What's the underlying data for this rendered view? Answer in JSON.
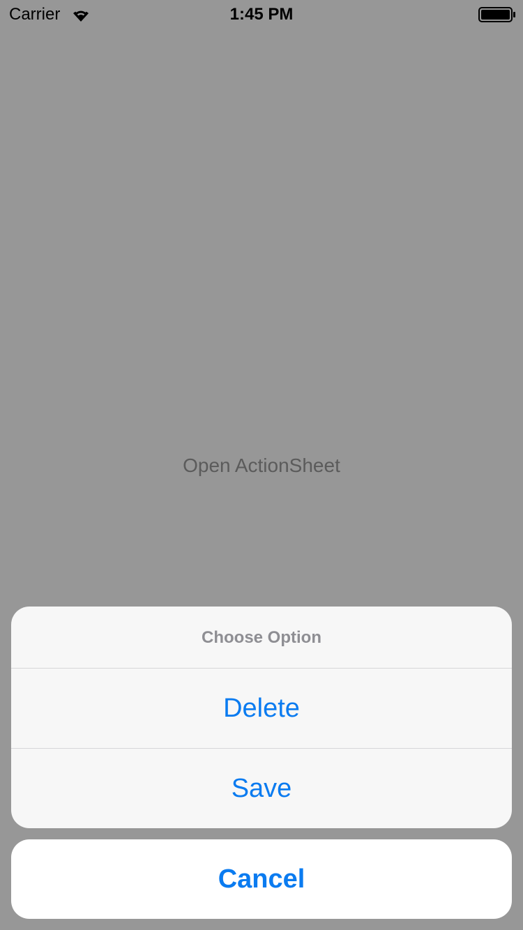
{
  "status_bar": {
    "carrier": "Carrier",
    "time": "1:45 PM",
    "wifi_icon": "wifi-icon",
    "battery_icon": "battery-icon"
  },
  "main": {
    "open_button_label": "Open ActionSheet"
  },
  "action_sheet": {
    "title": "Choose Option",
    "actions": [
      {
        "label": "Delete"
      },
      {
        "label": "Save"
      }
    ],
    "cancel_label": "Cancel"
  },
  "colors": {
    "background_dim": "#979797",
    "sheet_background": "#f7f7f7",
    "cancel_background": "#ffffff",
    "action_blue": "#0a7bf0",
    "title_gray": "#8e8e93",
    "open_button_gray": "#5b5b5b"
  }
}
